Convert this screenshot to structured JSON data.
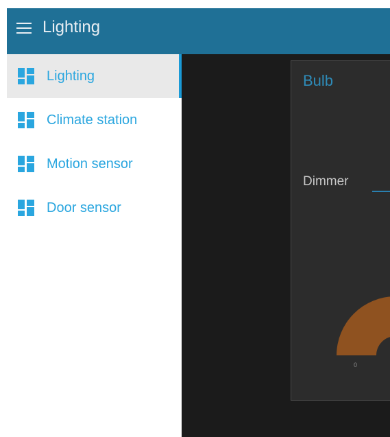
{
  "header": {
    "title": "Lighting",
    "menu_icon": "hamburger-menu-icon",
    "background": "#1f7096"
  },
  "sidebar": {
    "items": [
      {
        "label": "Lighting",
        "icon": "dashboard-icon",
        "active": true
      },
      {
        "label": "Climate station",
        "icon": "dashboard-icon",
        "active": false
      },
      {
        "label": "Motion sensor",
        "icon": "dashboard-icon",
        "active": false
      },
      {
        "label": "Door sensor",
        "icon": "dashboard-icon",
        "active": false
      }
    ],
    "accent": "#1a9ad6",
    "label_color": "#2aa6df"
  },
  "card": {
    "title": "Bulb",
    "dimmer_label": "Dimmer",
    "gauge_min": "0",
    "gauge_color": "#8f5220",
    "background": "#2c2c2c"
  }
}
